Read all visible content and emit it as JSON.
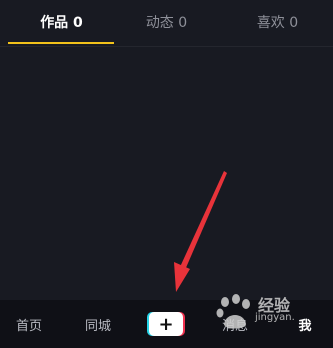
{
  "tabs": [
    {
      "label": "作品 0",
      "active": true
    },
    {
      "label": "动态 0",
      "active": false
    },
    {
      "label": "喜欢 0",
      "active": false
    }
  ],
  "bottom_nav": {
    "home": "首页",
    "city": "同城",
    "add": "+",
    "messages": "消息",
    "me": "我"
  },
  "watermark": {
    "text": "经验",
    "subtext": "jingyan."
  },
  "colors": {
    "background": "#181a22",
    "tab_indicator": "#f2c21b",
    "arrow": "#e8333a"
  }
}
